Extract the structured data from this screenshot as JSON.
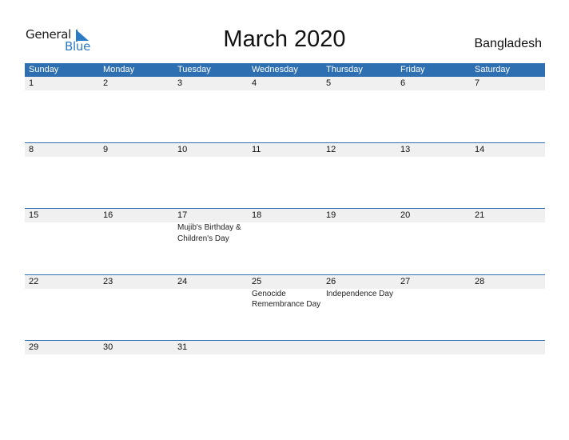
{
  "logo": {
    "word1": "General",
    "word2": "Blue"
  },
  "title": "March 2020",
  "country": "Bangladesh",
  "colors": {
    "header_bg": "#2e6fb1",
    "brand_blue": "#2a7ac4",
    "date_strip": "#f0f0f0"
  },
  "weekdays": [
    "Sunday",
    "Monday",
    "Tuesday",
    "Wednesday",
    "Thursday",
    "Friday",
    "Saturday"
  ],
  "weeks": [
    {
      "days": [
        "1",
        "2",
        "3",
        "4",
        "5",
        "6",
        "7"
      ],
      "events": [
        "",
        "",
        "",
        "",
        "",
        "",
        ""
      ]
    },
    {
      "days": [
        "8",
        "9",
        "10",
        "11",
        "12",
        "13",
        "14"
      ],
      "events": [
        "",
        "",
        "",
        "",
        "",
        "",
        ""
      ]
    },
    {
      "days": [
        "15",
        "16",
        "17",
        "18",
        "19",
        "20",
        "21"
      ],
      "events": [
        "",
        "",
        "Mujib's Birthday & Children's Day",
        "",
        "",
        "",
        ""
      ]
    },
    {
      "days": [
        "22",
        "23",
        "24",
        "25",
        "26",
        "27",
        "28"
      ],
      "events": [
        "",
        "",
        "",
        "Genocide Remembrance Day",
        "Independence Day",
        "",
        ""
      ]
    },
    {
      "days": [
        "29",
        "30",
        "31",
        "",
        "",
        "",
        ""
      ],
      "events": [
        "",
        "",
        "",
        "",
        "",
        "",
        ""
      ]
    }
  ]
}
